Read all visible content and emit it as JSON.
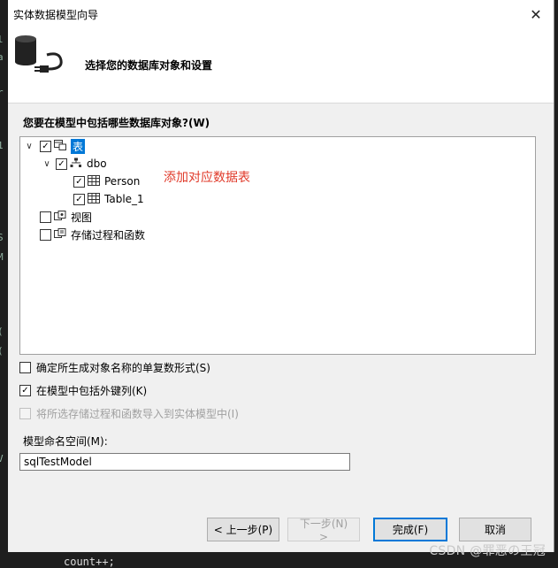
{
  "window": {
    "title": "实体数据模型向导",
    "close_glyph": "✕"
  },
  "header": {
    "subtitle": "选择您的数据库对象和设置"
  },
  "question": "您要在模型中包括哪些数据库对象?(W)",
  "tree": {
    "items": [
      {
        "label": "表",
        "checked": true,
        "expanded": true,
        "selected": true,
        "icon": "tables-icon"
      },
      {
        "label": "dbo",
        "checked": true,
        "expanded": true,
        "selected": false,
        "icon": "schema-icon"
      },
      {
        "label": "Person",
        "checked": true,
        "selected": false,
        "icon": "table-icon"
      },
      {
        "label": "Table_1",
        "checked": true,
        "selected": false,
        "icon": "table-icon"
      },
      {
        "label": "视图",
        "checked": false,
        "selected": false,
        "icon": "views-icon"
      },
      {
        "label": "存储过程和函数",
        "checked": false,
        "selected": false,
        "icon": "procedures-icon"
      }
    ]
  },
  "annotation": "添加对应数据表",
  "options": [
    {
      "label": "确定所生成对象名称的单复数形式(S)",
      "checked": false,
      "enabled": true
    },
    {
      "label": "在模型中包括外键列(K)",
      "checked": true,
      "enabled": true
    },
    {
      "label": "将所选存储过程和函数导入到实体模型中(I)",
      "checked": false,
      "enabled": false
    }
  ],
  "namespace": {
    "label": "模型命名空间(M):",
    "value": "sqlTestModel"
  },
  "buttons": {
    "previous": "< 上一步(P)",
    "next": "下一步(N) >",
    "finish": "完成(F)",
    "cancel": "取消"
  },
  "background": {
    "code_snippet": "count++;",
    "watermark": "CSDN @罪恶の王冠"
  },
  "colors": {
    "accent": "#0078d7",
    "annotation": "#e03a2a"
  }
}
